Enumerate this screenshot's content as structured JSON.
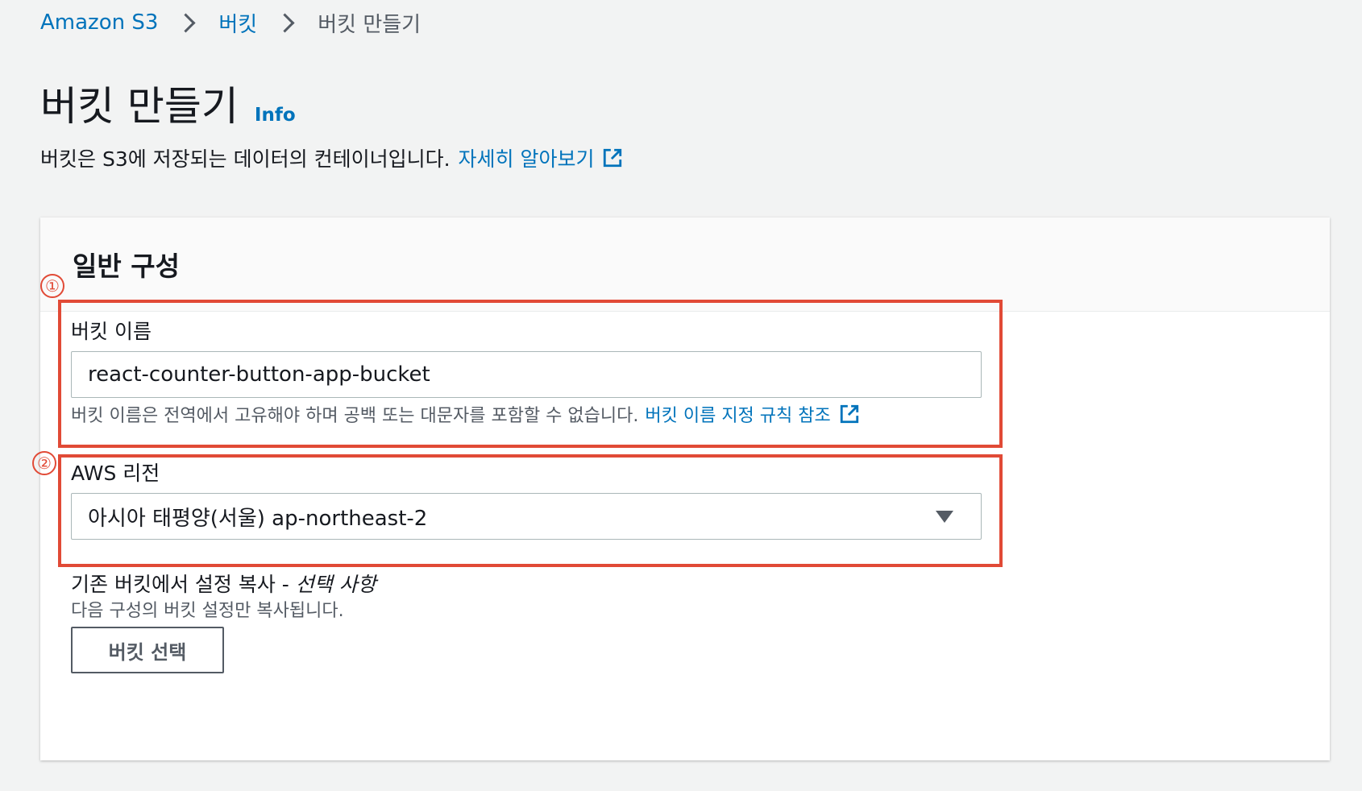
{
  "breadcrumb": {
    "items": [
      "Amazon S3",
      "버킷",
      "버킷 만들기"
    ]
  },
  "page": {
    "title": "버킷 만들기",
    "info_label": "Info",
    "description": "버킷은 S3에 저장되는 데이터의 컨테이너입니다.",
    "learn_more": "자세히 알아보기"
  },
  "general": {
    "title": "일반 구성",
    "marker_1": "①",
    "marker_2": "②",
    "bucket_name": {
      "label": "버킷 이름",
      "value": "react-counter-button-app-bucket",
      "helper": "버킷 이름은 전역에서 고유해야 하며 공백 또는 대문자를 포함할 수 없습니다.",
      "rules_link": "버킷 이름 지정 규칙 참조"
    },
    "region": {
      "label": "AWS 리전",
      "selected": "아시아 태평양(서울) ap-northeast-2"
    },
    "copy_settings": {
      "label": "기존 버킷에서 설정 복사 - ",
      "optional": "선택 사항",
      "description": "다음 구성의 버킷 설정만 복사됩니다.",
      "button": "버킷 선택"
    }
  },
  "colors": {
    "link": "#0073bb",
    "highlight": "#e14a36",
    "background": "#f2f3f3"
  }
}
